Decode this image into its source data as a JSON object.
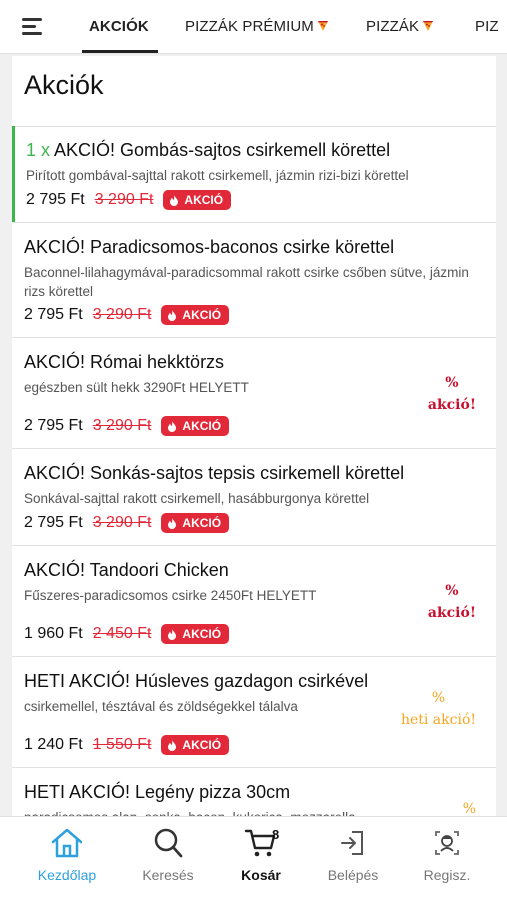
{
  "tabs": [
    {
      "label": "AKCIÓK",
      "active": true
    },
    {
      "label": "PIZZÁK PRÉMIUM",
      "icon": "pizza-icon"
    },
    {
      "label": "PIZZÁK",
      "icon": "pizza-icon"
    },
    {
      "label": "PIZ"
    }
  ],
  "section": {
    "title": "Akciók"
  },
  "items": [
    {
      "qty": "1 x",
      "name": "AKCIÓ! Gombás-sajtos csirkemell körettel",
      "desc": "Pirított gombával-sajttal rakott csirkemell, jázmin rizi-bizi körettel",
      "price": "2 795 Ft",
      "old_price": "3 290 Ft",
      "badge": "AKCIÓ"
    },
    {
      "name": "AKCIÓ! Paradicsomos-baconos csirke körettel",
      "desc": "Baconnel-lilahagymával-paradicsommal rakott csirke csőben sütve, jázmin rizs körettel",
      "price": "2 795 Ft",
      "old_price": "3 290 Ft",
      "badge": "AKCIÓ"
    },
    {
      "name": "AKCIÓ! Római hekktörzs",
      "desc": "egészben sült hekk 3290Ft HELYETT",
      "price": "2 795 Ft",
      "old_price": "3 290 Ft",
      "badge": "AKCIÓ",
      "promo_pct": "%",
      "promo_text": "akció!"
    },
    {
      "name": "AKCIÓ! Sonkás-sajtos tepsis csirkemell körettel",
      "desc": "Sonkával-sajttal rakott csirkemell, hasábburgonya körettel",
      "price": "2 795 Ft",
      "old_price": "3 290 Ft",
      "badge": "AKCIÓ"
    },
    {
      "name": "AKCIÓ! Tandoori Chicken",
      "desc": "Fűszeres-paradicsomos csirke 2450Ft HELYETT",
      "price": "1 960 Ft",
      "old_price": "2 450 Ft",
      "badge": "AKCIÓ",
      "promo_pct": "%",
      "promo_text": "akció!"
    },
    {
      "name": "HETI AKCIÓ! Húsleves gazdagon csirkével",
      "desc": "csirkemellel, tésztával és zöldségekkel tálalva",
      "price": "1 240 Ft",
      "old_price": "1 550 Ft",
      "badge": "AKCIÓ",
      "promo_pct": "%",
      "promo_text": "heti akció!"
    },
    {
      "name": "HETI AKCIÓ! Legény pizza 30cm",
      "desc": "paradicsomos alap, sonka, bacon, kukorica, mozzarella",
      "promo_pct": "%"
    }
  ],
  "nav": [
    {
      "label": "Kezdőlap",
      "icon": "home-icon",
      "active": true
    },
    {
      "label": "Keresés",
      "icon": "search-icon"
    },
    {
      "label": "Kosár",
      "icon": "cart-icon",
      "count": "8"
    },
    {
      "label": "Belépés",
      "icon": "login-icon"
    },
    {
      "label": "Regisz.",
      "icon": "register-icon"
    }
  ],
  "colors": {
    "accent_green": "#3cb54a",
    "sale_red": "#e2293a",
    "nav_active": "#2ea1dc",
    "promo_orange": "#f5a623"
  }
}
